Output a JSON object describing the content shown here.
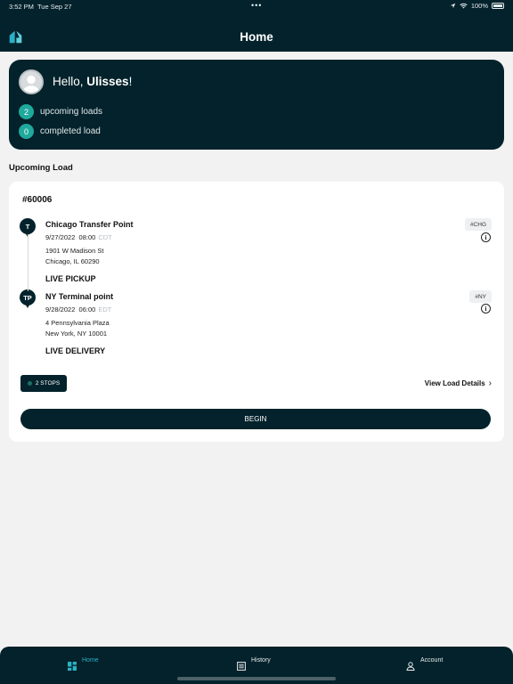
{
  "status_bar": {
    "time": "3:52 PM",
    "date": "Tue Sep 27",
    "battery": "100%"
  },
  "header": {
    "title": "Home"
  },
  "greeting": {
    "prefix": "Hello, ",
    "name": "Ulisses",
    "suffix": "!"
  },
  "stats": [
    {
      "count": "2",
      "label": "upcoming loads"
    },
    {
      "count": "0",
      "label": "completed load"
    }
  ],
  "section_title": "Upcoming Load",
  "load": {
    "id": "#60006",
    "stops": [
      {
        "pin": "T",
        "name": "Chicago Transfer Point",
        "date": "9/27/2022",
        "time": "08:00",
        "tz": "CDT",
        "address_line1": "1901 W Madison St",
        "address_line2": "Chicago, IL 60290",
        "tag": "#CHG",
        "kind": "LIVE PICKUP"
      },
      {
        "pin": "TP",
        "name": "NY Terminal point",
        "date": "9/28/2022",
        "time": "06:00",
        "tz": "EDT",
        "address_line1": "4 Pennsylvania Plaza",
        "address_line2": "New York, NY 10001",
        "tag": "#NY",
        "kind": "LIVE DELIVERY"
      }
    ],
    "stops_badge": "2 STOPS",
    "details_link": "View Load Details",
    "begin_label": "BEGIN"
  },
  "tabs": [
    {
      "label": "Home",
      "icon": "home-grid-icon",
      "active": true
    },
    {
      "label": "History",
      "icon": "history-list-icon",
      "active": false
    },
    {
      "label": "Account",
      "icon": "person-icon",
      "active": false
    }
  ],
  "colors": {
    "primary": "#03222b",
    "accent": "#1fa99c",
    "tab_active": "#2bb1c6",
    "background": "#f2f2f3"
  }
}
